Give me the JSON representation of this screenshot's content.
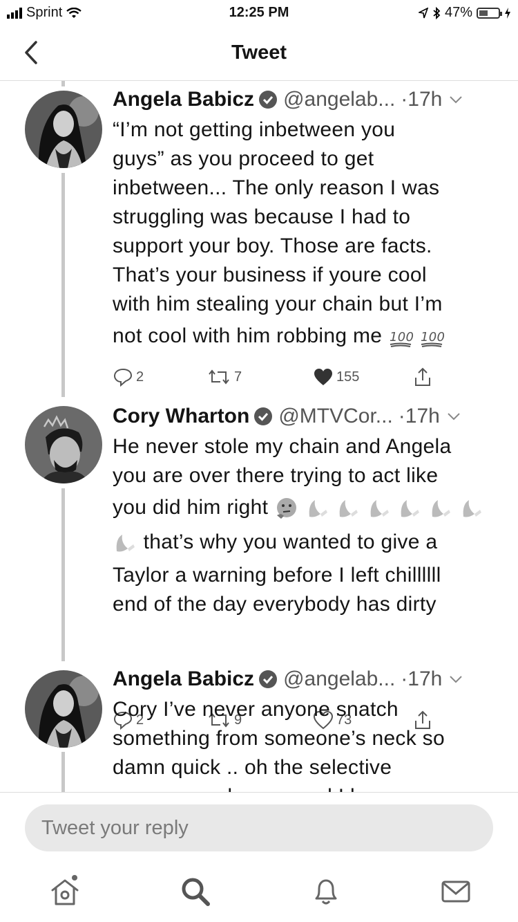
{
  "status_bar": {
    "carrier": "Sprint",
    "time": "12:25 PM",
    "battery_percent": "47%",
    "battery_level": 0.47
  },
  "nav": {
    "title": "Tweet"
  },
  "tweets": [
    {
      "name": "Angela Babicz",
      "handle": "@angelab...",
      "time": "·17h",
      "lines": [
        "“I’m not getting inbetween you",
        "guys” as you proceed to get",
        "inbetween... The only reason I was",
        "struggling was because I had to",
        "support your boy. Those are facts.",
        "That’s your business if youre cool",
        "with him stealing your chain but I’m",
        "not cool with him robbing me"
      ],
      "emojis": [
        "hundred-points-emoji",
        "hundred-points-emoji"
      ],
      "replies": "2",
      "retweets": "7",
      "likes": "155",
      "liked": true
    },
    {
      "name": "Cory Wharton",
      "handle": "@MTVCor...",
      "time": "·17h",
      "lines": [
        "He never stole my chain and Angela",
        "you are over there trying to act like",
        "you did him right",
        "that’s why you wanted to give a",
        "Taylor a warning before I left chillllll",
        "end of the day everybody has dirty"
      ],
      "replies": "2",
      "retweets": "9",
      "likes": "73",
      "liked": false
    },
    {
      "name": "Angela Babicz",
      "handle": "@angelab...",
      "time": "·17h",
      "lines": [
        "Cory I’ve never anyone snatch",
        "something from someone’s neck so",
        "damn quick .. oh the selective",
        "memory we have .. and I know you"
      ]
    }
  ],
  "reply": {
    "placeholder": "Tweet your reply"
  },
  "tabs": [
    "home-icon",
    "search-icon",
    "notifications-icon",
    "messages-icon"
  ]
}
